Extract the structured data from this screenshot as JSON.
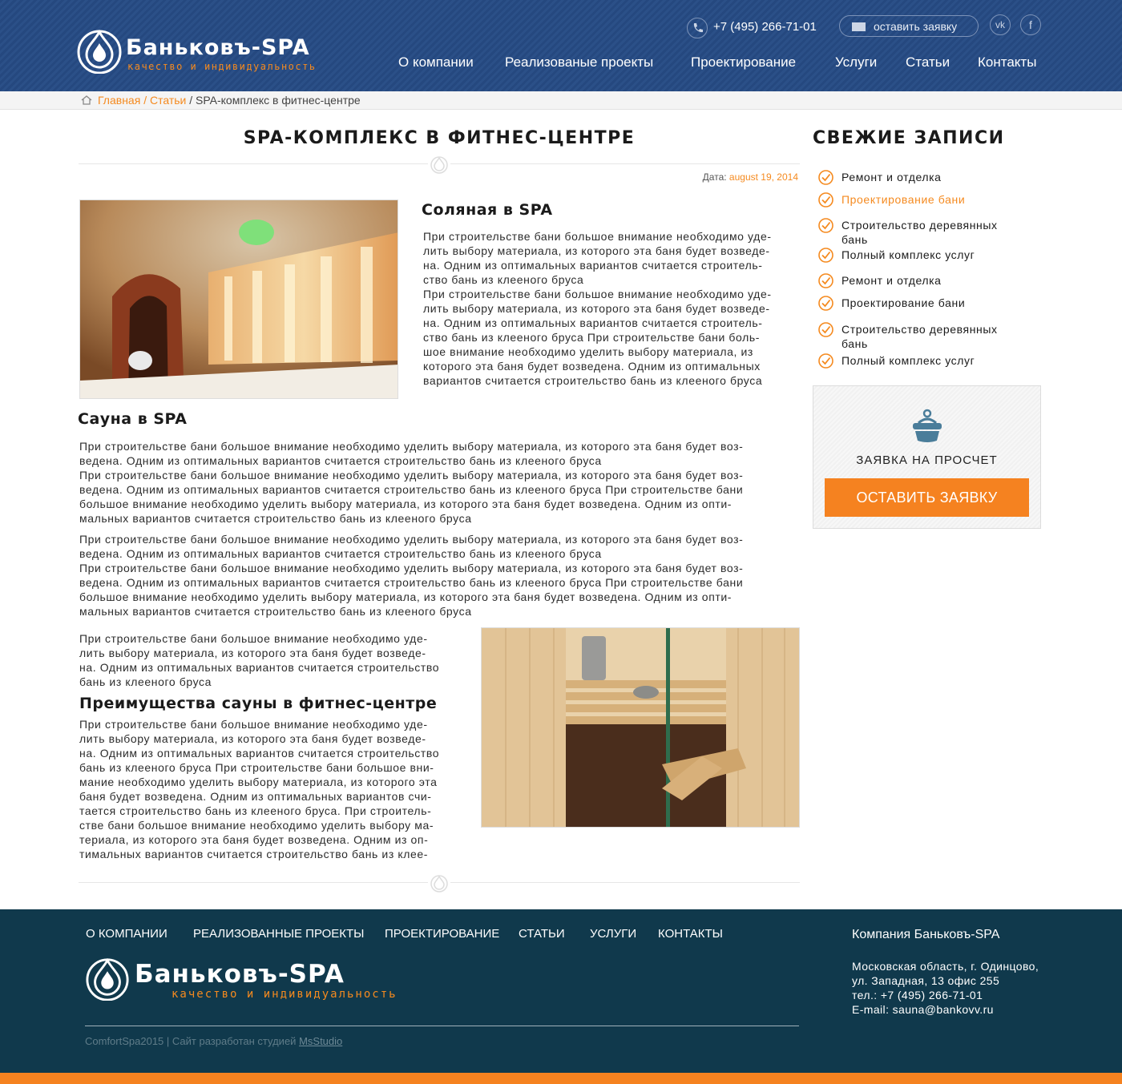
{
  "header": {
    "logo": {
      "brand": "Баньковъ-SPA",
      "tagline": "качество и индивидуальность"
    },
    "phone": "+7 (495) 266-71-01",
    "request_button": "оставить заявку",
    "social": {
      "vk": "vk",
      "facebook": "f"
    },
    "nav": [
      "О компании",
      "Реализованые проекты",
      "Проектирование",
      "Услуги",
      "Статьи",
      "Контакты"
    ]
  },
  "breadcrumb": {
    "home": "Главная",
    "sep": "/",
    "section": "Статьи",
    "current": "SPA-комплекс в фитнес-центре"
  },
  "article": {
    "title": "SPA-КОМПЛЕКС В ФИТНЕС-ЦЕНТРЕ",
    "date_label": "Дата:",
    "date_value": "august 19, 2014",
    "section1_title": "Соляная в SPA",
    "section1_text": [
      "При строительстве бани большое внимание необходимо уде-",
      "лить выбору материала, из которого эта баня будет возведе-",
      "на. Одним из оптимальных вариантов считается строитель-",
      "ство бань из клееного бруса",
      "При строительстве бани большое внимание необходимо уде-",
      "лить выбору материала, из которого эта баня будет возведе-",
      "на. Одним из оптимальных вариантов считается строитель-",
      "ство бань из клееного бруса При строительстве бани боль-",
      "шое внимание необходимо уделить выбору материала, из",
      "которого эта баня будет возведена. Одним из оптимальных",
      "вариантов считается строительство бань из клееного бруса"
    ],
    "section2_title": "Сауна  в SPA",
    "section2_para1": [
      "При строительстве бани большое внимание необходимо уделить выбору материала, из которого эта баня будет воз-",
      "ведена. Одним из оптимальных вариантов считается строительство бань из клееного бруса",
      "При строительстве бани большое внимание необходимо уделить выбору материала, из которого эта баня будет воз-",
      "ведена. Одним из оптимальных вариантов считается строительство бань из клееного бруса При строительстве бани",
      "большое внимание необходимо уделить выбору материала, из которого эта баня будет возведена. Одним из опти-",
      "мальных вариантов считается строительство бань из клееного бруса"
    ],
    "section2_para2": [
      "При строительстве бани большое внимание необходимо уделить выбору материала, из которого эта баня будет воз-",
      "ведена. Одним из оптимальных вариантов считается строительство бань из клееного бруса",
      "При строительстве бани большое внимание необходимо уделить выбору материала, из которого эта баня будет воз-",
      "ведена. Одним из оптимальных вариантов считается строительство бань из клееного бруса При строительстве бани",
      "большое внимание необходимо уделить выбору материала, из которого эта баня будет возведена. Одним из опти-",
      "мальных вариантов считается строительство бань из клееного бруса"
    ],
    "section3_intro": [
      "При строительстве бани большое внимание необходимо уде-",
      "лить выбору материала, из которого эта баня будет возведе-",
      "на. Одним из оптимальных вариантов считается строительство",
      "бань из клееного бруса"
    ],
    "section3_title": "Преимущества сауны в фитнес-центре",
    "section3_text": [
      "При строительстве бани большое внимание необходимо уде-",
      "лить выбору материала, из которого эта баня будет возведе-",
      "на. Одним из оптимальных вариантов считается строительство",
      "бань из клееного бруса При строительстве бани большое вни-",
      "мание необходимо уделить выбору материала, из которого эта",
      "баня будет возведена. Одним из оптимальных вариантов счи-",
      "тается строительство бань из клееного бруса. При строитель-",
      "стве бани большое внимание необходимо уделить выбору ма-",
      "териала, из которого эта баня будет возведена. Одним из оп-",
      "тимальных вариантов считается строительство бань из клее-"
    ]
  },
  "sidebar": {
    "title": "СВЕЖИЕ ЗАПИСИ",
    "recent": [
      {
        "label": "Ремонт и отделка",
        "active": false
      },
      {
        "label": "Проектирование бани",
        "active": true
      },
      {
        "label": "Строительство деревянных бань",
        "active": false
      },
      {
        "label": "Полный комплекс услуг",
        "active": false
      },
      {
        "label": "Ремонт и отделка",
        "active": false
      },
      {
        "label": "Проектирование бани",
        "active": false
      },
      {
        "label": "Строительство деревянных бань",
        "active": false
      },
      {
        "label": "Полный комплекс услуг",
        "active": false
      }
    ],
    "widget_caption": "ЗАЯВКА НА ПРОСЧЕТ",
    "widget_button": "ОСТАВИТЬ ЗАЯВКУ"
  },
  "footer": {
    "nav": [
      "О КОМПАНИИ",
      "РЕАЛИЗОВАННЫЕ ПРОЕКТЫ",
      "ПРОЕКТИРОВАНИЕ",
      "СТАТЬИ",
      "УСЛУГИ",
      "КОНТАКТЫ"
    ],
    "logo": {
      "brand": "Баньковъ-SPA",
      "tagline": "качество и индивидуальность"
    },
    "copyright": "ComfortSpa2015 | Сайт разработан студией",
    "studio": "MsStudio",
    "company": "Компания Баньковъ-SPA",
    "address": [
      "Московская область, г. Одинцово,",
      "ул. Западная, 13 офис 255",
      "тел.: +7 (495) 266-71-01",
      "E-mail: sauna@bankovv.ru"
    ]
  },
  "colors": {
    "header_blue": "#2b5088",
    "accent_orange": "#f58220",
    "footer_teal": "#10394c"
  }
}
